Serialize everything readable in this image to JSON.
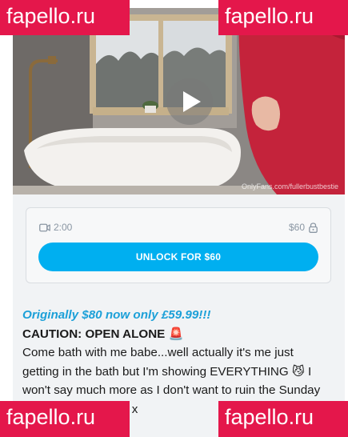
{
  "media": {
    "source_watermark": "OnlyFans.com/fullerbustbestie",
    "play_icon": "play-icon"
  },
  "lock_card": {
    "duration": "2:00",
    "duration_icon": "video-camera-icon",
    "price": "$60",
    "price_icon": "lock-icon",
    "unlock_label": "UNLOCK FOR $60"
  },
  "post": {
    "promo_line": "Originally $80 now only £59.99!!!",
    "caution_line": "CAUTION: OPEN ALONE",
    "caution_emoji": "🚨",
    "body_text": "Come bath with me babe...well actually it's me just getting in the bath but I'm showing EVERYTHING",
    "body_emoji": "😼",
    "body_text_2": "I won't say much more as I don't want to ruin the Sunday surprise but... enjoy x"
  },
  "watermarks": {
    "top_left": "fapello.ru",
    "top_right": "fapello.ru",
    "bottom_left": "fapello.ru",
    "bottom_right": "fapello.ru"
  },
  "colors": {
    "accent": "#00aff0",
    "promo": "#1ca0d8",
    "badge": "#e4174b"
  }
}
